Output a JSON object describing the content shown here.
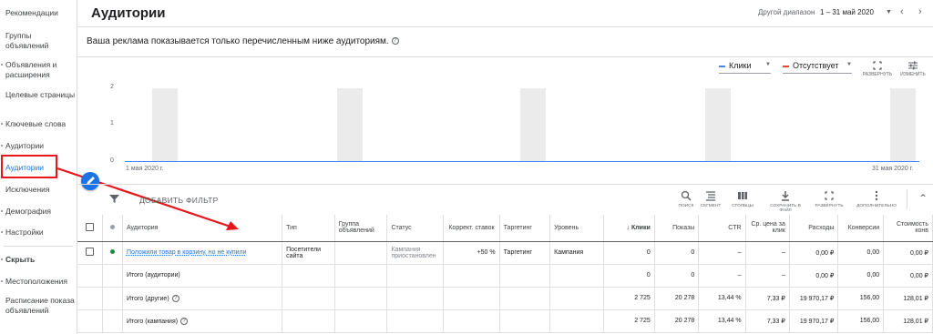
{
  "sidebar": {
    "items": [
      {
        "label": "Рекомендации"
      },
      {
        "label": "Группы объявлений"
      },
      {
        "label": "Объявления и расширения"
      },
      {
        "label": "Целевые страницы"
      },
      {
        "label": "Ключевые слова"
      },
      {
        "label": "Аудитории"
      },
      {
        "label": "Аудитории"
      },
      {
        "label": "Исключения"
      },
      {
        "label": "Демография"
      },
      {
        "label": "Настройки"
      },
      {
        "label": "Скрыть"
      },
      {
        "label": "Местоположения"
      },
      {
        "label": "Расписание показа объявлений"
      }
    ]
  },
  "header": {
    "title": "Аудитории",
    "date_label": "Другой диапазон",
    "date_range": "1 – 31 май 2020"
  },
  "notice": "Ваша реклама показывается только перечисленным ниже аудиториям.",
  "chart": {
    "legend": [
      "Клики",
      "Отсутствует"
    ],
    "tools": [
      "РАЗВЕРНУТЬ",
      "ИЗМЕНИТЬ"
    ],
    "colors": {
      "clicks": "#4285f4",
      "missing": "#ea4335"
    }
  },
  "chart_data": {
    "type": "line",
    "x_start": "1 мая 2020 г.",
    "x_end": "31 мая 2020 г.",
    "y_ticks": [
      "2",
      "1",
      "0"
    ],
    "ylim": [
      0,
      2
    ],
    "series": [
      {
        "name": "Клики",
        "values": [
          0,
          0
        ]
      }
    ]
  },
  "toolbar": {
    "add_filter": "ДОБАВИТЬ ФИЛЬТР",
    "tools": [
      "ПОИСК",
      "СЕГМЕНТ",
      "СТОЛБЦЫ",
      "СОХРАНИТЬ В ФАЙЛ",
      "РАЗВЕРНУТЬ",
      "ДОПОЛНИТЕЛЬНО"
    ]
  },
  "table": {
    "headers": [
      "Аудитория",
      "Тип",
      "Группа объявлений",
      "Статус",
      "Коррект. ставок",
      "Таргетинг",
      "Уровень",
      "Клики",
      "Показы",
      "CTR",
      "Ср. цена за клик",
      "Расходы",
      "Конверсии",
      "Стоимость конв"
    ],
    "rows": [
      [
        "Положили товар в корзину, но не купили",
        "Посетители сайта",
        "",
        "Кампания приостановлен",
        "+50 %",
        "Таргетинг",
        "Кампания",
        "0",
        "0",
        "–",
        "–",
        "0,00 ₽",
        "0,00",
        "0,00 ₽"
      ],
      [
        "Итого (аудитории)",
        "",
        "",
        "",
        "",
        "",
        "",
        "0",
        "0",
        "–",
        "–",
        "0,00 ₽",
        "0,00",
        "0,00 ₽"
      ],
      [
        "Итого (другие)",
        "",
        "",
        "",
        "",
        "",
        "",
        "2 725",
        "20 278",
        "13,44 %",
        "7,33 ₽",
        "19 970,17 ₽",
        "156,00",
        "128,01 ₽"
      ],
      [
        "Итого (кампания)",
        "",
        "",
        "",
        "",
        "",
        "",
        "2 725",
        "20 278",
        "13,44 %",
        "7,33 ₽",
        "19 970,17 ₽",
        "156,00",
        "128,01 ₽"
      ]
    ]
  }
}
